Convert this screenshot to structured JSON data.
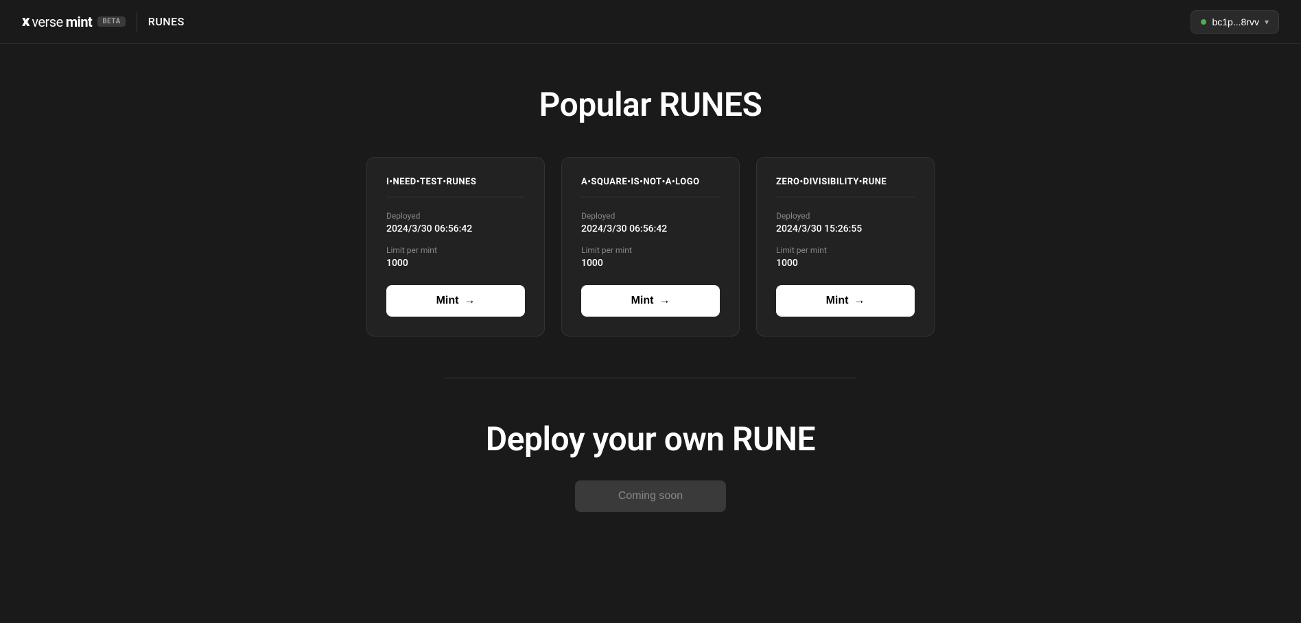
{
  "header": {
    "logo": {
      "x": "x",
      "verse": "verse",
      "mint": "mint",
      "beta_label": "BETA"
    },
    "nav_label": "RUNES",
    "wallet": {
      "address": "bc1p...8rvv",
      "chevron": "▾",
      "dot_color": "#4caf50"
    }
  },
  "main": {
    "popular_title": "Popular RUNES",
    "cards": [
      {
        "name": "I•NEED•TEST•RUNES",
        "deployed_label": "Deployed",
        "deployed_date": "2024/3/30 06:56:42",
        "limit_label": "Limit per mint",
        "limit_value": "1000",
        "mint_label": "Mint"
      },
      {
        "name": "A•SQUARE•IS•NOT•A•LOGO",
        "deployed_label": "Deployed",
        "deployed_date": "2024/3/30 06:56:42",
        "limit_label": "Limit per mint",
        "limit_value": "1000",
        "mint_label": "Mint"
      },
      {
        "name": "ZERO•DIVISIBILITY•RUNE",
        "deployed_label": "Deployed",
        "deployed_date": "2024/3/30 15:26:55",
        "limit_label": "Limit per mint",
        "limit_value": "1000",
        "mint_label": "Mint"
      }
    ],
    "deploy_title": "Deploy your own RUNE",
    "coming_soon_label": "Coming soon"
  }
}
